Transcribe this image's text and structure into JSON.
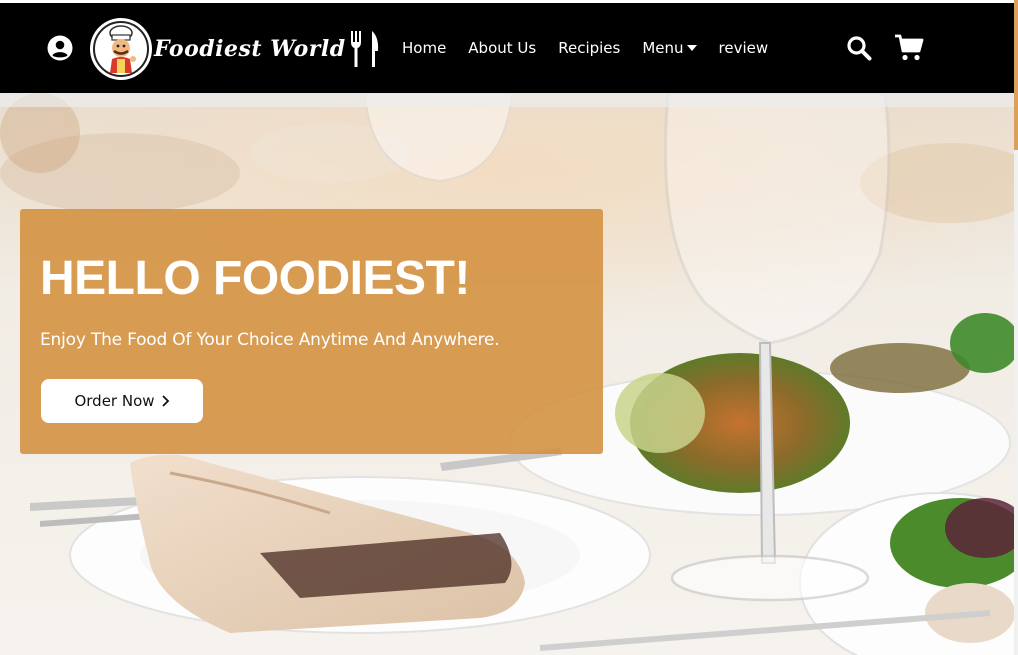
{
  "header": {
    "logo_text": "Foodiest World",
    "nav": [
      {
        "label": "Home"
      },
      {
        "label": "About Us"
      },
      {
        "label": "Recipies"
      },
      {
        "label": "Menu"
      },
      {
        "label": "review"
      }
    ],
    "icons": {
      "user": "user-circle-icon",
      "search": "search-icon",
      "cart": "cart-icon",
      "menu_dropdown": "caret-down-icon"
    }
  },
  "hero": {
    "title": "HELLO FOODIEST!",
    "subtitle": "Enjoy The Food Of Your Choice Anytime And Anywhere.",
    "cta_label": "Order Now",
    "cta_icon": "chevron-right-icon"
  },
  "colors": {
    "navbar_bg": "#000000",
    "card_bg": "#d38f3e",
    "text_light": "#ffffff",
    "button_bg": "#ffffff"
  }
}
